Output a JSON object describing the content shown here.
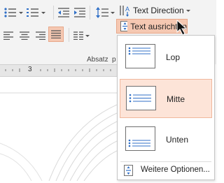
{
  "ribbon": {
    "text_direction_label": "Text Direction",
    "text_align_label": "Text ausrichten",
    "group_label": "Absatz",
    "group_label_overflow": "p"
  },
  "ruler": {
    "mark": "3"
  },
  "align_menu": {
    "options": [
      {
        "label": "Lop",
        "selected": false
      },
      {
        "label": "Mitte",
        "selected": true
      },
      {
        "label": "Unten",
        "selected": false
      }
    ],
    "more_options_label": "Weitere Optionen..."
  },
  "colors": {
    "accent_selected": "#f5c8b2",
    "menu_selected": "#fde4d8",
    "icon_blue": "#2f6fc7"
  }
}
